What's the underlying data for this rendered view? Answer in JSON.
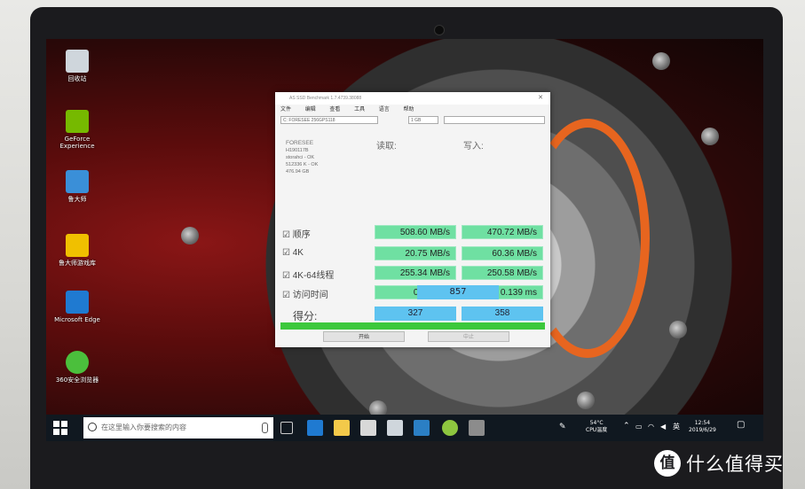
{
  "desktop": {
    "icons": [
      {
        "label": "回收站",
        "icon": "recycle-bin-icon",
        "color": "#cfd6dc"
      },
      {
        "label": "GeForce Experience",
        "icon": "geforce-icon",
        "color": "#76b900"
      },
      {
        "label": "鲁大师",
        "icon": "ludashi-icon",
        "color": "#3a8fd8"
      },
      {
        "label": "鲁大师游戏库",
        "icon": "game-library-icon",
        "color": "#f0c000"
      },
      {
        "label": "Microsoft Edge",
        "icon": "edge-icon",
        "color": "#1f7ad1"
      },
      {
        "label": "360安全浏览器",
        "icon": "360-browser-icon",
        "color": "#4bbf3c"
      }
    ]
  },
  "app": {
    "title": "AS SSD Benchmark 1.7.4739.38088",
    "menu": [
      "文件",
      "编辑",
      "查看",
      "工具",
      "语言",
      "帮助"
    ],
    "drive_select": "C: FORESEE 256GPS118",
    "size_select": "1 GB",
    "drive_info": [
      "FORESEE",
      "H190117B",
      "storahci - OK",
      "512336 K - OK",
      "476.94 GB"
    ],
    "col_read": "读取:",
    "col_write": "写入:",
    "rows": [
      {
        "label": "顺序",
        "read": "508.60 MB/s",
        "write": "470.72 MB/s"
      },
      {
        "label": "4K",
        "read": "20.75 MB/s",
        "write": "60.36 MB/s"
      },
      {
        "label": "4K-64线程",
        "read": "255.34 MB/s",
        "write": "250.58 MB/s"
      },
      {
        "label": "访问时间",
        "read": "0.058 ms",
        "write": "0.139 ms"
      }
    ],
    "score_label": "得分:",
    "score_read": "327",
    "score_write": "358",
    "score_total": "857",
    "progress": 1.0,
    "start_button": "开始",
    "abort_button": "中止"
  },
  "taskbar": {
    "search_placeholder": "在这里输入你要搜索的内容",
    "temp": "54°C",
    "temp_label": "CPU温度",
    "time": "12:54",
    "date": "2019/6/29",
    "accent": "#101820"
  },
  "watermark": {
    "badge": "值",
    "text": "什么值得买"
  }
}
